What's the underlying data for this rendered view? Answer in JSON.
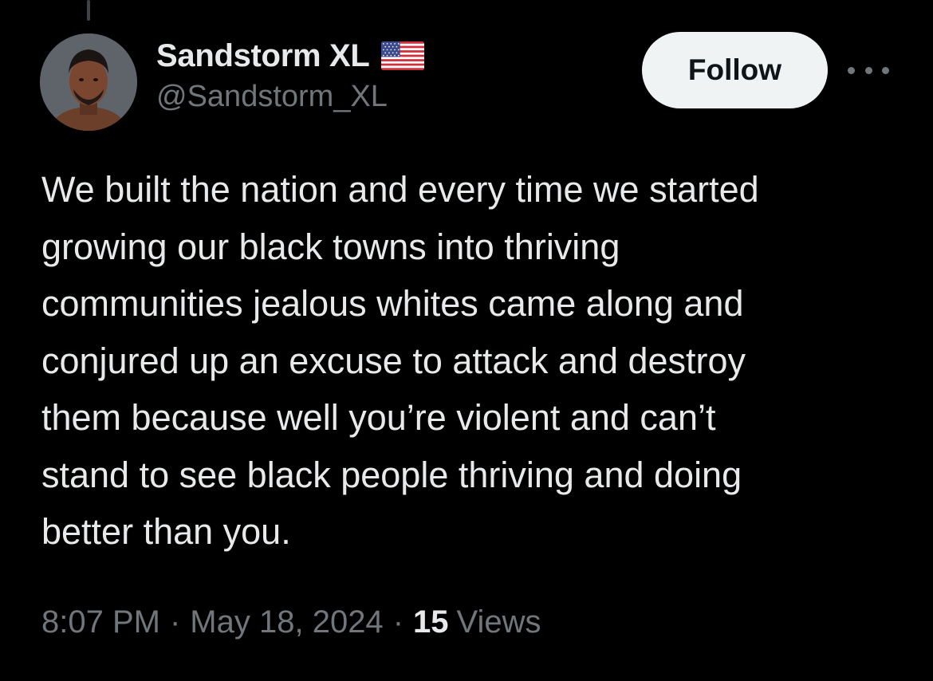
{
  "user": {
    "display_name": "Sandstorm XL",
    "handle": "@Sandstorm_XL",
    "badge_icon": "us-flag-icon"
  },
  "actions": {
    "follow_label": "Follow",
    "more_icon": "more-horizontal-icon"
  },
  "tweet": {
    "text": "We built the nation and every time we started\ngrowing our black towns into thriving\ncommunities jealous whites came along and\nconjured up an excuse to attack and destroy\nthem because well you’re violent and can’t\nstand to see black people thriving and doing\nbetter than you."
  },
  "meta": {
    "time": "8:07 PM",
    "separator": "·",
    "date": "May 18, 2024",
    "views_count": "15",
    "views_label": "Views"
  },
  "colors": {
    "background": "#000000",
    "primary_text": "#e7e9ea",
    "secondary_text": "#71767b",
    "follow_button_bg": "#eff3f4",
    "follow_button_text": "#0f1419"
  }
}
